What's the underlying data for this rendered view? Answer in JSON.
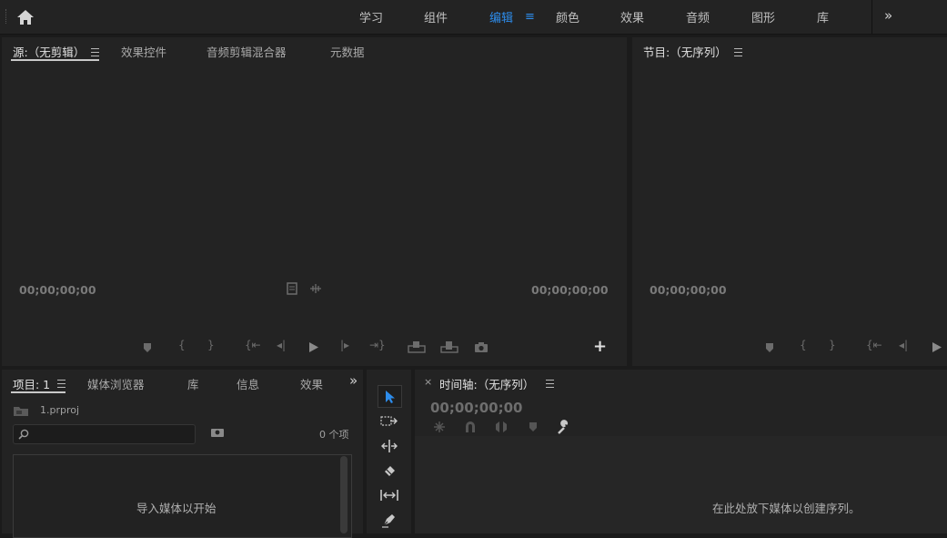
{
  "workspaces": {
    "items": [
      "学习",
      "组件",
      "编辑",
      "颜色",
      "效果",
      "音频",
      "图形",
      "库"
    ],
    "active": "编辑"
  },
  "source_panel": {
    "tabs": [
      "源:（无剪辑）",
      "效果控件",
      "音频剪辑混合器",
      "元数据"
    ],
    "timecode_left": "00;00;00;00",
    "timecode_right": "00;00;00;00"
  },
  "program_panel": {
    "title": "节目:（无序列）",
    "timecode": "00;00;00;00"
  },
  "project_panel": {
    "tabs": [
      "项目: 1",
      "媒体浏览器",
      "库",
      "信息",
      "效果"
    ],
    "file_name": "1.prproj",
    "search_placeholder": "",
    "item_count": "0 个项",
    "empty_message": "导入媒体以开始"
  },
  "timeline_panel": {
    "close": "×",
    "title": "时间轴:（无序列）",
    "timecode": "00;00;00;00",
    "empty_message": "在此处放下媒体以创建序列。"
  },
  "colors": {
    "accent": "#2d8ceb",
    "panel_bg": "#232323",
    "app_bg": "#1b1b1b"
  }
}
